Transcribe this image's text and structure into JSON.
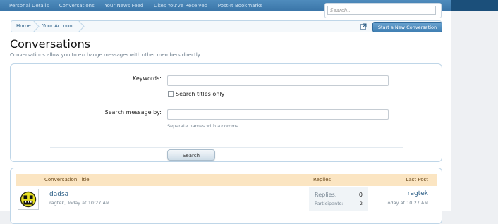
{
  "nav": {
    "tabs": [
      "Personal Details",
      "Conversations",
      "Your News Feed",
      "Likes You've Received",
      "Post-It Bookmarks"
    ]
  },
  "search": {
    "placeholder": "Search..."
  },
  "breadcrumb": {
    "items": [
      "Home",
      "Your Account"
    ]
  },
  "actions": {
    "start_conversation": "Start a New Conversation"
  },
  "page": {
    "title": "Conversations",
    "description": "Conversations allow you to exchange messages with other members directly."
  },
  "form": {
    "keywords_label": "Keywords:",
    "keywords_value": "",
    "search_titles_label": "Search titles only",
    "search_titles_checked": false,
    "message_by_label": "Search message by:",
    "message_by_value": "",
    "message_by_hint": "Separate names with a comma.",
    "submit_label": "Search"
  },
  "list": {
    "columns": {
      "title": "Conversation Title",
      "replies": "Replies",
      "last_post": "Last Post"
    },
    "rows": [
      {
        "title": "dadsa",
        "author": "ragtek",
        "time": "Today at 10:27 AM",
        "replies_label": "Replies:",
        "replies": "0",
        "participants_label": "Participants:",
        "participants": "2",
        "last_user": "ragtek",
        "last_time": "Today at 10:27 AM"
      }
    ]
  },
  "colors": {
    "nav_bar": "#3a75a8",
    "link": "#2b5e86",
    "panel_border": "#bfd6e8",
    "list_header": "#fbe5c2"
  }
}
